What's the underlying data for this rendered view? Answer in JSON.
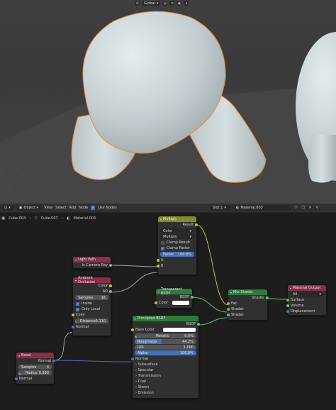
{
  "viewport": {
    "orientation_label": "Global",
    "colors": {
      "sky": "#3f3f3f",
      "floor": "#444444",
      "mesh": "#c2cbcd",
      "outline": "#e98a2c"
    }
  },
  "node_editor_header": {
    "editor_icon": "node-tree-icon",
    "mode": "Object",
    "menus": [
      "View",
      "Select",
      "Add",
      "Node"
    ],
    "use_nodes_label": "Use Nodes",
    "slot": "Slot 1",
    "material": "Material.003"
  },
  "breadcrumb": [
    "Cube.004",
    "Cube.007",
    "Material.003"
  ],
  "nodes": {
    "multiply": {
      "title": "Multiply",
      "output": "Result",
      "type_dropdown": "Color",
      "op_dropdown": "Multiply",
      "clamp_result": "Clamp Result",
      "clamp_factor": "Clamp Factor",
      "factor_label": "Factor",
      "factor_value": "100.0%",
      "input_a": "A",
      "input_b": "B",
      "header_color": "#83892c"
    },
    "light_path": {
      "title": "Light Path",
      "output": "Is Camera Ray",
      "header_color": "#8b2c49"
    },
    "ambient_occlusion": {
      "title": "Ambient Occlusion",
      "out_color": "Color",
      "out_ao": "AO",
      "samples_label": "Samples",
      "samples_value": "16",
      "inside": "Inside",
      "only_local": "Only Local",
      "in_color": "Color",
      "distance_label": "Distance",
      "distance_value": "0.110",
      "in_normal": "Normal",
      "header_color": "#8b2c49"
    },
    "transparent_bsdf": {
      "title": "Transparent BSDF",
      "output": "BSDF",
      "color_label": "Color",
      "header_color": "#2e7b3a"
    },
    "mix_shader": {
      "title": "Mix Shader",
      "output": "Shader",
      "fac": "Fac",
      "shader1": "Shader",
      "shader2": "Shader",
      "header_color": "#2e7b3a"
    },
    "material_output": {
      "title": "Material Output",
      "target": "All",
      "surface": "Surface",
      "volume": "Volume",
      "displacement": "Displacement",
      "header_color": "#8b2c49"
    },
    "principled_bsdf": {
      "title": "Principled BSDF",
      "output": "BSDF",
      "base_color": "Base Color",
      "metallic_label": "Metallic",
      "metallic_value": "0.0%",
      "roughness_label": "Roughness",
      "roughness_value": "44.2%",
      "ior_label": "IOR",
      "ior_value": "1.000",
      "alpha_label": "Alpha",
      "alpha_value": "100.0%",
      "normal": "Normal",
      "panels": [
        "Subsurface",
        "Specular",
        "Transmission",
        "Coat",
        "Sheen",
        "Emission"
      ],
      "header_color": "#2e7b3a"
    },
    "bevel": {
      "title": "Bevel",
      "output": "Normal",
      "samples_label": "Samples",
      "samples_value": "4",
      "radius_label": "Radius",
      "radius_value": "0.290",
      "in_normal": "Normal",
      "header_color": "#8b2c49"
    }
  }
}
